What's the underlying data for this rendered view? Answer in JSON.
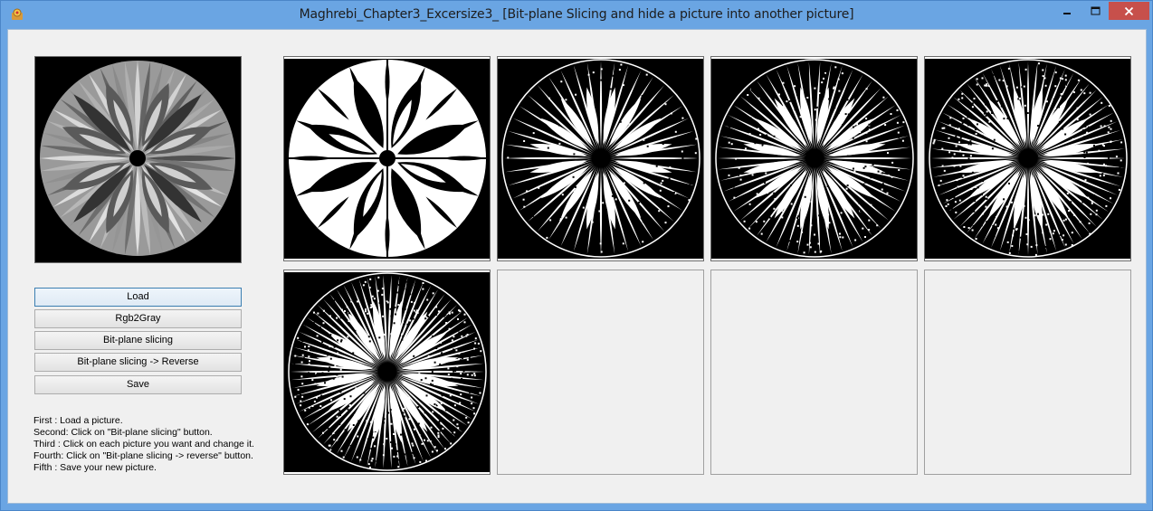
{
  "window": {
    "title": "Maghrebi_Chapter3_Excersize3_ [Bit-plane Slicing and hide a  picture into another picture]",
    "icon": "app-icon",
    "controls": [
      "minimize-icon",
      "maximize-icon",
      "close-icon"
    ]
  },
  "original_image": {
    "name": "grayscale-mandala-image"
  },
  "bit_planes": [
    {
      "name": "bit-plane-1",
      "state": "filled",
      "detail": 1
    },
    {
      "name": "bit-plane-2",
      "state": "filled",
      "detail": 2
    },
    {
      "name": "bit-plane-3",
      "state": "filled",
      "detail": 3
    },
    {
      "name": "bit-plane-4",
      "state": "filled",
      "detail": 4
    },
    {
      "name": "bit-plane-5",
      "state": "filled",
      "detail": 5
    },
    {
      "name": "bit-plane-6",
      "state": "empty"
    },
    {
      "name": "bit-plane-7",
      "state": "empty"
    },
    {
      "name": "bit-plane-8",
      "state": "empty"
    }
  ],
  "buttons": {
    "load": "Load",
    "rgb2gray": "Rgb2Gray",
    "bitplane": "Bit-plane slicing",
    "reverse": "Bit-plane slicing -> Reverse",
    "save": "Save"
  },
  "instructions": [
    "First : Load a picture.",
    "Second: Click on \"Bit-plane slicing\" button.",
    "Third : Click on each picture you want and change it.",
    "Fourth: Click on \"Bit-plane slicing -> reverse\" button.",
    "Fifth : Save your new picture."
  ],
  "colors": {
    "titlebar": "#6aa5e3",
    "client": "#f0f0f0",
    "close": "#c7504b"
  }
}
